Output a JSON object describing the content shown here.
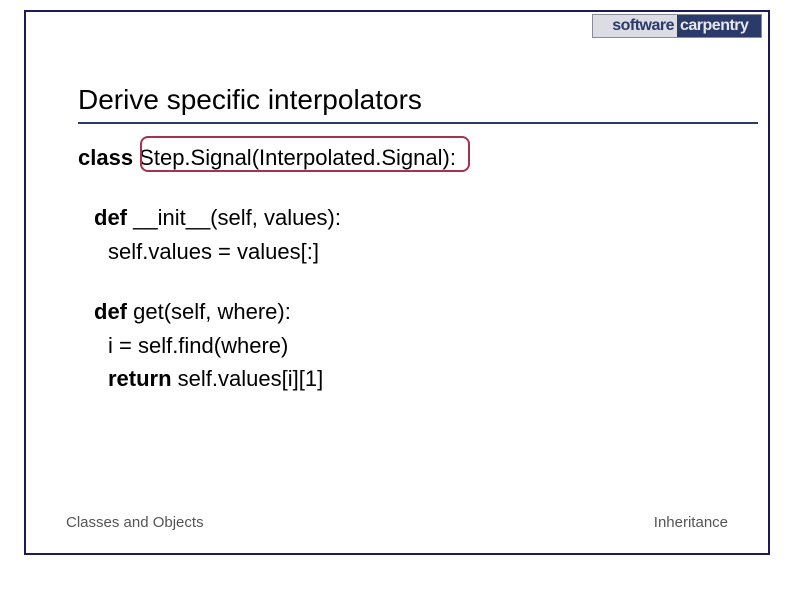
{
  "logo": {
    "left": "software",
    "right": "carpentry"
  },
  "title": "Derive specific interpolators",
  "code": {
    "class_kw": "class",
    "class_decl": " Step.Signal(Interpolated.Signal):",
    "init": {
      "def_kw": "def",
      "sig": " __init__(self, values):",
      "body": "self.values = values[:]"
    },
    "get": {
      "def_kw": "def",
      "sig": " get(self, where):",
      "body1": "i = self.find(where)",
      "return_kw": "return",
      "body2": " self.values[i][1]"
    }
  },
  "footer": {
    "left": "Classes and Objects",
    "right": "Inheritance"
  }
}
